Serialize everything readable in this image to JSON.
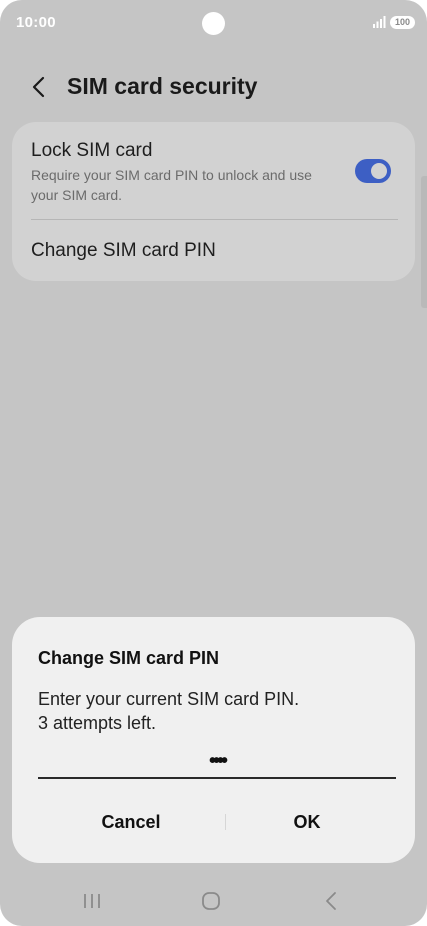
{
  "status_bar": {
    "time": "10:00",
    "battery": "100"
  },
  "header": {
    "title": "SIM card security"
  },
  "settings": {
    "lock_sim": {
      "title": "Lock SIM card",
      "description": "Require your SIM card PIN to unlock and use your SIM card.",
      "enabled": true
    },
    "change_pin": {
      "label": "Change SIM card PIN"
    }
  },
  "dialog": {
    "title": "Change SIM card PIN",
    "message_line1": "Enter your current SIM card PIN.",
    "message_line2": "3 attempts left.",
    "pin_value": "••••",
    "cancel_label": "Cancel",
    "ok_label": "OK"
  },
  "colors": {
    "accent": "#3d5fc4",
    "scrim": "#c5c5c5",
    "dialog_bg": "#f0f0f0"
  },
  "icons": [
    "signal-icon",
    "back-arrow-icon",
    "recents-icon",
    "home-icon",
    "nav-back-icon"
  ]
}
